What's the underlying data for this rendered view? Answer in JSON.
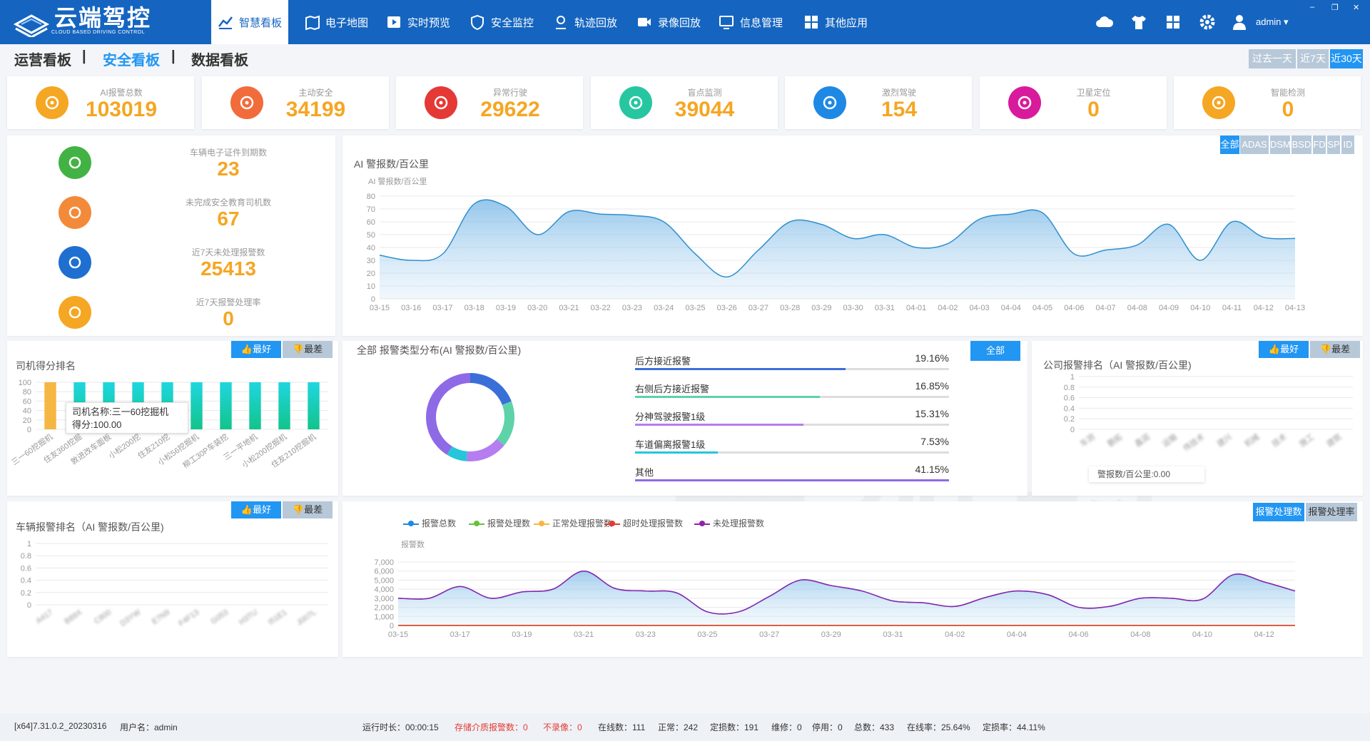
{
  "app": {
    "logo_cn": "云端驾控",
    "logo_en": "CLOUD BASED DRIVING CONTROL",
    "user": "admin ▾"
  },
  "nav": [
    {
      "label": "智慧看板",
      "icon": "chart-icon"
    },
    {
      "label": "电子地图",
      "icon": "map-icon"
    },
    {
      "label": "实时预览",
      "icon": "play-icon"
    },
    {
      "label": "安全监控",
      "icon": "shield-icon"
    },
    {
      "label": "轨迹回放",
      "icon": "location-icon"
    },
    {
      "label": "录像回放",
      "icon": "video-icon"
    },
    {
      "label": "信息管理",
      "icon": "monitor-icon"
    },
    {
      "label": "其他应用",
      "icon": "grid-icon"
    }
  ],
  "tabs": {
    "ops": "运营看板",
    "sep1": "|",
    "safety": "安全看板",
    "sep2": "|",
    "data": "数据看板"
  },
  "ranges": [
    "过去一天",
    "近7天",
    "近30天"
  ],
  "stats": [
    {
      "label": "AI报警总数",
      "value": "103019",
      "color": "#f5a623"
    },
    {
      "label": "主动安全",
      "value": "34199",
      "color": "#f26b3a"
    },
    {
      "label": "异常行驶",
      "value": "29622",
      "color": "#e53935"
    },
    {
      "label": "盲点监测",
      "value": "39044",
      "color": "#26c6a0"
    },
    {
      "label": "激烈驾驶",
      "value": "154",
      "color": "#1e88e5"
    },
    {
      "label": "卫星定位",
      "value": "0",
      "color": "#d81b9c"
    },
    {
      "label": "智能检测",
      "value": "0",
      "color": "#f5a623"
    }
  ],
  "left_metrics": [
    {
      "label": "车辆电子证件到期数",
      "value": "23",
      "color": "#43b244"
    },
    {
      "label": "未完成安全教育司机数",
      "value": "67",
      "color": "#f28a3a"
    },
    {
      "label": "近7天未处理报警数",
      "value": "25413",
      "color": "#1e6fd0"
    },
    {
      "label": "近7天报警处理率",
      "value": "0",
      "color": "#f5a623"
    }
  ],
  "ai_filters": [
    "全部",
    "ADAS",
    "DSM",
    "BSD",
    "FD",
    "SP",
    "ID"
  ],
  "ai_chart": {
    "title": "AI 警报数/百公里",
    "chart_data": {
      "type": "area",
      "ylabel": "AI 警报数/百公里",
      "ylim": [
        0,
        80
      ],
      "y_ticks": [
        0,
        10,
        20,
        30,
        40,
        50,
        60,
        70,
        80
      ],
      "categories": [
        "03-15",
        "03-16",
        "03-17",
        "03-18",
        "03-19",
        "03-20",
        "03-21",
        "03-22",
        "03-23",
        "03-24",
        "03-25",
        "03-26",
        "03-27",
        "03-28",
        "03-29",
        "03-30",
        "03-31",
        "04-01",
        "04-02",
        "04-03",
        "04-04",
        "04-05",
        "04-06",
        "04-07",
        "04-08",
        "04-09",
        "04-10",
        "04-11",
        "04-12",
        "04-13"
      ],
      "values": [
        34,
        30,
        35,
        74,
        72,
        50,
        68,
        66,
        65,
        60,
        35,
        17,
        38,
        60,
        58,
        47,
        50,
        40,
        43,
        62,
        66,
        67,
        35,
        38,
        42,
        58,
        30,
        60,
        48,
        47
      ],
      "grid": true,
      "legend": "none",
      "line_color": "#2f8fcf"
    }
  },
  "driver_rank": {
    "title": "司机得分排名",
    "best": "最好",
    "worst": "最差",
    "tooltip_name": "司机名称:三一60挖掘机",
    "tooltip_score": "得分:100.00",
    "chart_data": {
      "type": "bar",
      "ylim": [
        0,
        100
      ],
      "y_ticks": [
        0,
        20,
        40,
        60,
        80,
        100
      ],
      "categories": [
        "三一60挖掘机",
        "住友360挖掘",
        "敦进改车面板",
        "小松200挖",
        "住友210挖",
        "小松56挖掘机",
        "柳工30P车装挖",
        "三一平地机",
        "小松200挖掘机",
        "住友210挖掘机"
      ],
      "values": [
        100,
        100,
        100,
        100,
        100,
        100,
        100,
        100,
        100,
        100
      ]
    }
  },
  "alarm_type": {
    "title": "全部 报警类型分布(AI 警报数/百公里)",
    "all_button": "全部",
    "chart_data": {
      "type": "pie",
      "categories": [
        "后方接近报警",
        "右侧后方接近报警",
        "分神驾驶报警1级",
        "车道偏离报警1级",
        "其他"
      ],
      "values": [
        19.16,
        16.85,
        15.31,
        7.53,
        41.15
      ],
      "labels": [
        "19.16%",
        "16.85%",
        "15.31%",
        "7.53%",
        "41.15%"
      ],
      "colors": [
        "#3a6fd8",
        "#5dd3a7",
        "#b57df0",
        "#26c6da",
        "#8e6ae6"
      ]
    }
  },
  "company_rank": {
    "title": "公司报警排名（AI 警报数/百公里)",
    "best": "最好",
    "worst": "最差",
    "tooltip": "警报数/百公里:0.00",
    "chart_data": {
      "type": "bar",
      "ylim": [
        0,
        1
      ],
      "y_ticks": [
        "0",
        "0.2",
        "0.4",
        "0.6",
        "0.8",
        "1"
      ],
      "categories": [
        "车测",
        "鹏拓",
        "鑫润",
        "运输",
        "伟技术",
        "建兴",
        "机械",
        "技术",
        "施工",
        "建筑"
      ],
      "values": [
        0,
        0,
        0,
        0,
        0,
        0,
        0,
        0,
        0,
        0
      ]
    }
  },
  "vehicle_rank": {
    "title": "车辆报警排名（AI 警报数/百公里)",
    "best": "最好",
    "worst": "最差",
    "chart_data": {
      "type": "bar",
      "ylim": [
        0,
        1
      ],
      "y_ticks": [
        "0",
        "0.2",
        "0.4",
        "0.6",
        "0.8",
        "1"
      ],
      "categories": [
        "A417",
        "B89X",
        "C800",
        "D3YW",
        "E7N9",
        "F4F13",
        "G053",
        "H3TU",
        "I51E1",
        "J007L"
      ],
      "values": [
        0,
        0,
        0,
        0,
        0,
        0,
        0,
        0,
        0,
        0
      ]
    }
  },
  "alarm_trend": {
    "buttons": [
      "报警处理数",
      "报警处理率"
    ],
    "chart_data": {
      "type": "line",
      "ylabel": "报警数",
      "ylim": [
        0,
        7000
      ],
      "y_ticks": [
        "0",
        "1,000",
        "2,000",
        "3,000",
        "4,000",
        "5,000",
        "6,000",
        "7,000"
      ],
      "x": [
        "03-15",
        "03-16",
        "03-17",
        "03-18",
        "03-19",
        "03-20",
        "03-21",
        "03-22",
        "03-23",
        "03-24",
        "03-25",
        "03-26",
        "03-27",
        "03-28",
        "03-29",
        "03-30",
        "03-31",
        "04-01",
        "04-02",
        "04-03",
        "04-04",
        "04-05",
        "04-06",
        "04-07",
        "04-08",
        "04-09",
        "04-10",
        "04-11",
        "04-12",
        "04-13"
      ],
      "x_labels": [
        "03-15",
        "03-17",
        "03-19",
        "03-21",
        "03-23",
        "03-25",
        "03-27",
        "03-29",
        "03-31",
        "04-02",
        "04-04",
        "04-06",
        "04-08",
        "04-10",
        "04-12"
      ],
      "series": [
        {
          "name": "报警总数",
          "color": "#1e88e5",
          "values": [
            3000,
            3000,
            4300,
            3000,
            3700,
            4000,
            6000,
            4100,
            3800,
            3600,
            1500,
            1500,
            3200,
            5000,
            4400,
            3800,
            2700,
            2500,
            2100,
            3100,
            3800,
            3400,
            2000,
            2100,
            3000,
            3000,
            2900,
            5600,
            4800,
            3800
          ]
        },
        {
          "name": "报警处理数",
          "color": "#66c23a",
          "values": [
            0,
            0,
            0,
            0,
            0,
            0,
            0,
            0,
            0,
            0,
            0,
            0,
            0,
            0,
            0,
            0,
            0,
            0,
            0,
            0,
            0,
            0,
            0,
            0,
            0,
            0,
            0,
            0,
            0,
            0
          ]
        },
        {
          "name": "正常处理报警数",
          "color": "#f5b642",
          "values": [
            0,
            0,
            0,
            0,
            0,
            0,
            0,
            0,
            0,
            0,
            0,
            0,
            0,
            0,
            0,
            0,
            0,
            0,
            0,
            0,
            0,
            0,
            0,
            0,
            0,
            0,
            0,
            0,
            0,
            0
          ]
        },
        {
          "name": "超时处理报警数",
          "color": "#e53935",
          "values": [
            0,
            0,
            0,
            0,
            0,
            0,
            0,
            0,
            0,
            0,
            0,
            0,
            0,
            0,
            0,
            0,
            0,
            0,
            0,
            0,
            0,
            0,
            0,
            0,
            0,
            0,
            0,
            0,
            0,
            0
          ]
        },
        {
          "name": "未处理报警数",
          "color": "#8e24aa",
          "values": [
            3000,
            3000,
            4300,
            3000,
            3700,
            4000,
            6000,
            4100,
            3800,
            3600,
            1500,
            1500,
            3200,
            5000,
            4400,
            3800,
            2700,
            2500,
            2100,
            3100,
            3800,
            3400,
            2000,
            2100,
            3000,
            3000,
            2900,
            5600,
            4800,
            3800
          ]
        }
      ]
    }
  },
  "watermark": {
    "cn": "云端驾控",
    "en": "CLOUD BASED DRIVING CONTROL"
  },
  "status": [
    {
      "text": "[x64]7.31.0.2_20230316",
      "red": false
    },
    {
      "text": "用户名：admin",
      "red": false
    },
    {
      "text": "运行时长：00:00:15",
      "red": false
    },
    {
      "text": "存储介质报警数：0",
      "red": true
    },
    {
      "text": "不录像：0",
      "red": true
    },
    {
      "text": "在线数：111",
      "red": false
    },
    {
      "text": "正常：242",
      "red": false
    },
    {
      "text": "定损数：191",
      "red": false
    },
    {
      "text": "维修：0",
      "red": false
    },
    {
      "text": "停用：0",
      "red": false
    },
    {
      "text": "总数：433",
      "red": false
    },
    {
      "text": "在线率：25.64%",
      "red": false
    },
    {
      "text": "定损率：44.11%",
      "red": false
    }
  ]
}
